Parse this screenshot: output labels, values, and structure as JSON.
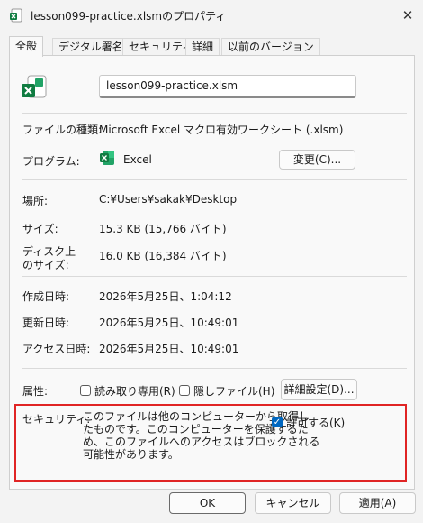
{
  "window": {
    "title": "lesson099-practice.xlsmのプロパティ",
    "close_glyph": "✕"
  },
  "tabs": [
    {
      "label": "全般"
    },
    {
      "label": "デジタル署名"
    },
    {
      "label": "セキュリティ"
    },
    {
      "label": "詳細"
    },
    {
      "label": "以前のバージョン"
    }
  ],
  "general": {
    "filename": "lesson099-practice.xlsm",
    "file_type_label": "ファイルの種類:",
    "file_type_value": "Microsoft Excel マクロ有効ワークシート (.xlsm)",
    "program_label": "プログラム:",
    "program_value": "Excel",
    "change_button": "変更(C)...",
    "location_label": "場所:",
    "location_value": "C:¥Users¥sakak¥Desktop",
    "size_label": "サイズ:",
    "size_value": "15.3 KB (15,766 バイト)",
    "disk_size_label_1": "ディスク上",
    "disk_size_label_2": "のサイズ:",
    "disk_size_value": "16.0 KB (16,384 バイト)",
    "created_label": "作成日時:",
    "created_value": "2026年5月25日、1:04:12",
    "modified_label": "更新日時:",
    "modified_value": "2026年5月25日、10:49:01",
    "accessed_label": "アクセス日時:",
    "accessed_value": "2026年5月25日、10:49:01",
    "attributes_label": "属性:",
    "readonly_label": "読み取り専用(R)",
    "hidden_label": "隠しファイル(H)",
    "advanced_button": "詳細設定(D)...",
    "security_label": "セキュリティ:",
    "security_line1": "このファイルは他のコンピューターから取得し",
    "security_line2": "たものです。このコンピューターを保護するた",
    "security_line3": "め、このファイルへのアクセスはブロックされる",
    "security_line4": "可能性があります。",
    "unblock_label": "許可する(K)",
    "unblock_checked": true,
    "readonly_checked": false,
    "hidden_checked": false
  },
  "footer": {
    "ok": "OK",
    "cancel": "キャンセル",
    "apply": "適用(A)"
  },
  "colors": {
    "excel_green": "#107c41",
    "highlight_red": "#e02424",
    "checkbox_blue": "#0067c0"
  },
  "icons": {
    "file": "excel-macro-file-icon",
    "program": "excel-app-icon",
    "check": "checkmark-icon"
  }
}
